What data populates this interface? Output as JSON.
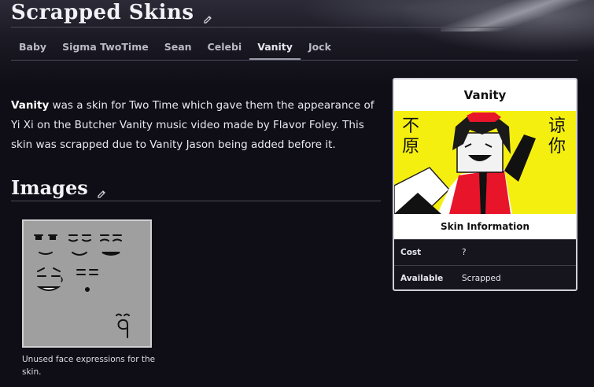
{
  "page": {
    "title": "Scrapped Skins"
  },
  "tabs": [
    {
      "label": "Baby"
    },
    {
      "label": "Sigma TwoTime"
    },
    {
      "label": "Sean"
    },
    {
      "label": "Celebi"
    },
    {
      "label": "Vanity"
    },
    {
      "label": "Jock"
    }
  ],
  "active_tab": "Vanity",
  "intro": {
    "bold": "Vanity",
    "text": " was a skin for Two Time which gave them the appearance of Yi Xi on the Butcher Vanity music video made by Flavor Foley. This skin was scrapped due to Vanity Jason being added before it."
  },
  "images_section": {
    "title": "Images"
  },
  "gallery": {
    "caption": "Unused face expressions for the skin."
  },
  "infobox": {
    "title": "Vanity",
    "chars_left": "不原",
    "chars_right": "谅你",
    "subtitle": "Skin Information",
    "rows": [
      {
        "label": "Cost",
        "value": "?"
      },
      {
        "label": "Available",
        "value": "Scrapped"
      }
    ]
  },
  "colors": {
    "background": "#0f0e17",
    "infobox_image_bg": "#f5ef10",
    "gallery_bg": "#9f9f9f"
  }
}
